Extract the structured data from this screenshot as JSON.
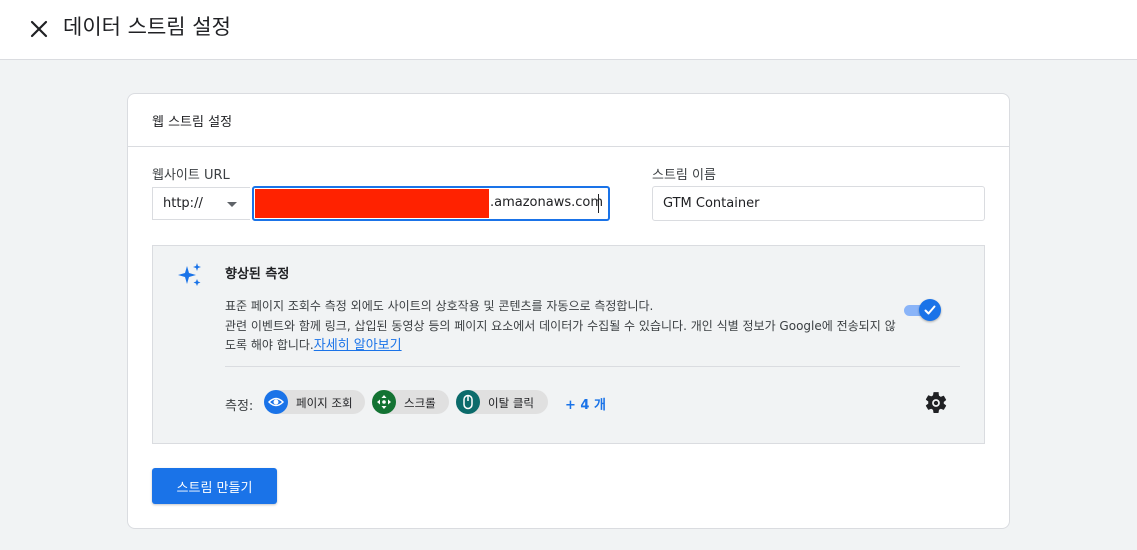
{
  "header": {
    "title": "데이터 스트림 설정",
    "close_icon": "close-icon"
  },
  "card": {
    "title": "웹 스트림 설정",
    "website_url": {
      "label": "웹사이트 URL",
      "protocol": "http://",
      "value_visible": ".amazonaws.com",
      "redacted": true
    },
    "stream_name": {
      "label": "스트림 이름",
      "value": "GTM Container"
    },
    "enhanced": {
      "icon": "sparkle-icon",
      "title": "향상된 측정",
      "description_line1": "표준 페이지 조회수 측정 외에도 사이트의 상호작용 및 콘텐츠를 자동으로 측정합니다.",
      "description_line2": "관련 이벤트와 함께 링크, 삽입된 동영상 등의 페이지 요소에서 데이터가 수집될 수 있습니다. 개인 식별 정보가 Google에 전송되지 않도록 해야 합니다.",
      "learn_more": "자세히 알아보기",
      "toggle_on": true,
      "measure_label": "측정:",
      "chips": [
        {
          "label": "페이지 조회",
          "icon": "eye-icon",
          "color": "#1a73e8"
        },
        {
          "label": "스크롤",
          "icon": "move-arrows-icon",
          "color": "#137333"
        },
        {
          "label": "이탈 클릭",
          "icon": "mouse-icon",
          "color": "#0b6b6b"
        }
      ],
      "more": "+ 4 개",
      "settings_icon": "gear-icon"
    },
    "create_button": "스트림 만들기"
  },
  "colors": {
    "accent": "#1a73e8",
    "redaction": "#ff2200"
  }
}
